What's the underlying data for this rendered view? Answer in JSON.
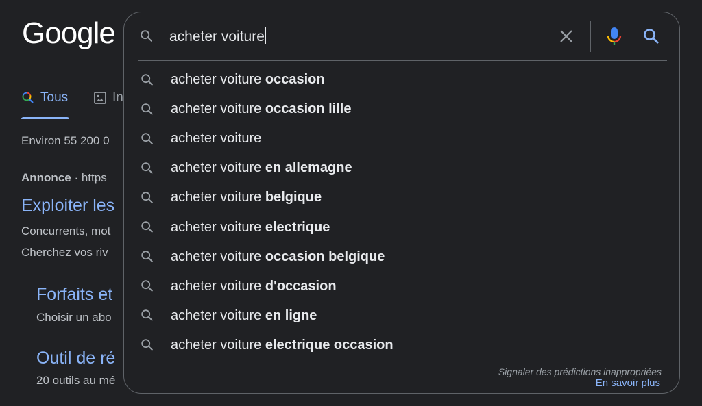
{
  "logo": "Google",
  "tabs": [
    {
      "label": "Tous",
      "icon": "google-search-icon",
      "active": true
    },
    {
      "label": "In",
      "icon": "image-icon"
    }
  ],
  "results": {
    "count": "Environ 55 200 0",
    "ad_label": "Annonce",
    "ad_sep": " · ",
    "ad_url": "https",
    "title1": "Exploiter les",
    "desc1a": "Concurrents, mot",
    "desc1b": "Cherchez vos riv",
    "sub1_title": "Forfaits et",
    "sub1_desc": "Choisir un abo",
    "sub2_title": "Outil de ré",
    "sub2_desc": "20 outils au mé"
  },
  "search": {
    "query": "acheter voiture",
    "suggestions": [
      {
        "prefix": "acheter voiture ",
        "bold": "occasion"
      },
      {
        "prefix": "acheter voiture ",
        "bold": "occasion lille"
      },
      {
        "prefix": "acheter voiture",
        "bold": ""
      },
      {
        "prefix": "acheter voiture ",
        "bold": "en allemagne"
      },
      {
        "prefix": "acheter voiture ",
        "bold": "belgique"
      },
      {
        "prefix": "acheter voiture ",
        "bold": "electrique"
      },
      {
        "prefix": "acheter voiture ",
        "bold": "occasion belgique"
      },
      {
        "prefix": "acheter voiture ",
        "bold": "d'occasion"
      },
      {
        "prefix": "acheter voiture ",
        "bold": "en ligne"
      },
      {
        "prefix": "acheter voiture ",
        "bold": "electrique occasion"
      }
    ],
    "report_label": "Signaler des prédictions inappropriées",
    "learn_more": "En savoir plus"
  },
  "colors": {
    "background": "#202124",
    "link": "#8ab4f8",
    "text": "#e8eaed",
    "muted": "#9aa0a6"
  }
}
